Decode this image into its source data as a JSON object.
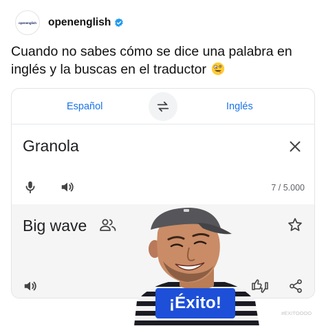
{
  "post": {
    "avatar_logo_text": "openenglish",
    "username": "openenglish",
    "verified_icon": "verified-badge-icon",
    "caption": "Cuando no sabes cómo se dice una palabra en inglés y la buscas en el traductor",
    "caption_emoji": "zany-face-emoji"
  },
  "translator": {
    "source_language": "Español",
    "target_language": "Inglés",
    "source_text": "Granola",
    "char_count": "7 / 5.000",
    "translated_text": "Big wave",
    "icons": [
      "swap-icon",
      "clear-icon",
      "microphone-icon",
      "speaker-icon",
      "people-icon",
      "star-icon",
      "speaker-icon",
      "rate-icon",
      "share-icon"
    ]
  },
  "sticker": {
    "label": "¡Éxito!",
    "hashtag": "#EXITOOOO"
  },
  "colors": {
    "accent_blue": "#1a73e8",
    "badge_blue": "#1d4fd8",
    "verified_blue": "#1d9bf0",
    "output_bg": "#f5f5f5"
  }
}
